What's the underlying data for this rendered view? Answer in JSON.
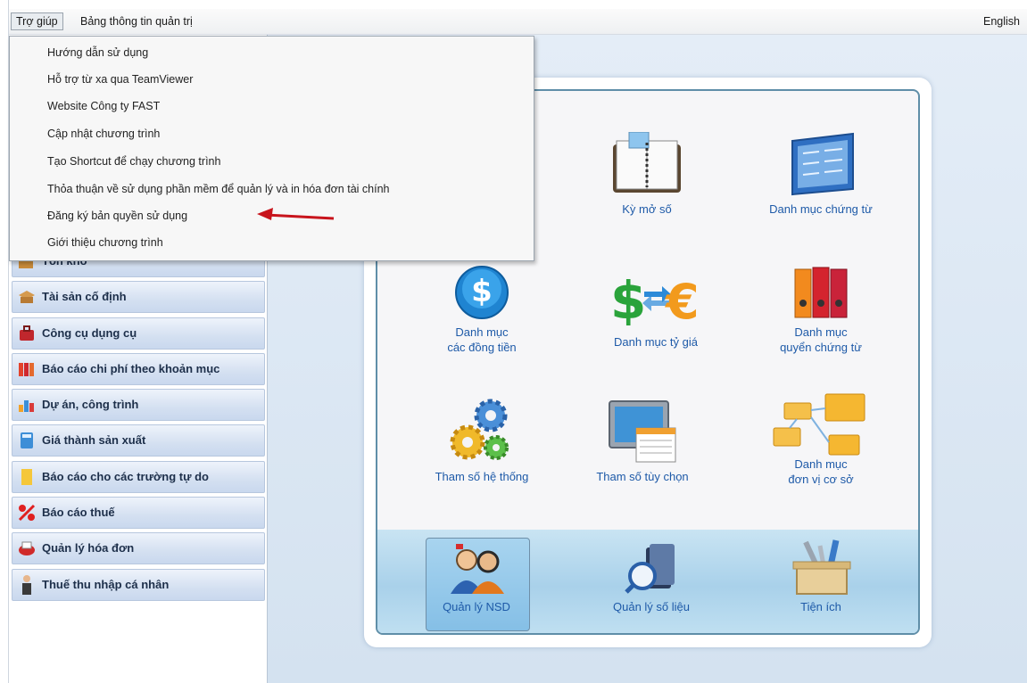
{
  "menubar": {
    "help": "Trợ giúp",
    "admin_dashboard": "Bảng thông tin quản trị",
    "language": "English"
  },
  "help_menu": {
    "items": [
      "Hướng dẫn sử dụng",
      "Hỗ trợ từ xa qua TeamViewer",
      "Website Công ty FAST",
      "Cập nhật chương trình",
      "Tạo Shortcut để chạy chương trình",
      "Thỏa thuận về sử dụng phần mềm để quản lý và in hóa đơn tài chính",
      "Đăng ký bản quyền sử dụng",
      "Giới thiệu chương trình"
    ],
    "highlighted_index": 6
  },
  "sidebar": {
    "partial_label": "Tồn kho",
    "items": [
      {
        "label": "Tài sản cố định",
        "icon": "fixed-asset-icon"
      },
      {
        "label": "Công cụ dụng cụ",
        "icon": "tools-bag-icon"
      },
      {
        "label": "Báo cáo chi phí theo khoản mục",
        "icon": "binders-icon"
      },
      {
        "label": "Dự án, công trình",
        "icon": "bar-chart-icon"
      },
      {
        "label": "Giá thành sản xuất",
        "icon": "calculator-icon"
      },
      {
        "label": "Báo cáo cho các trường tự do",
        "icon": "note-icon"
      },
      {
        "label": "Báo cáo thuế",
        "icon": "percent-icon"
      },
      {
        "label": "Quản lý hóa đơn",
        "icon": "invoice-icon"
      },
      {
        "label": "Thuế thu nhập cá nhân",
        "icon": "person-icon"
      }
    ]
  },
  "dashboard": {
    "tiles": [
      {
        "label": "Kỳ mở số",
        "icon": "ledger-book-icon"
      },
      {
        "label": "Danh mục chứng từ",
        "icon": "document-board-icon"
      },
      {
        "label": "Danh mục\ncác đồng tiền",
        "icon": "dollar-coin-icon"
      },
      {
        "label": "Danh mục tỷ giá",
        "icon": "currency-exchange-icon"
      },
      {
        "label": "Danh mục\nquyển chứng từ",
        "icon": "binders-icon"
      },
      {
        "label": "Tham số hệ thống",
        "icon": "gears-icon"
      },
      {
        "label": "Tham số tùy chọn",
        "icon": "monitor-options-icon"
      },
      {
        "label": "Danh mục\nđơn vị cơ sở",
        "icon": "folder-tree-icon"
      }
    ],
    "bottom": [
      {
        "label": "Quản lý NSD",
        "icon": "users-icon"
      },
      {
        "label": "Quản lý số liệu",
        "icon": "database-search-icon"
      },
      {
        "label": "Tiện ích",
        "icon": "toolbox-icon"
      }
    ]
  }
}
